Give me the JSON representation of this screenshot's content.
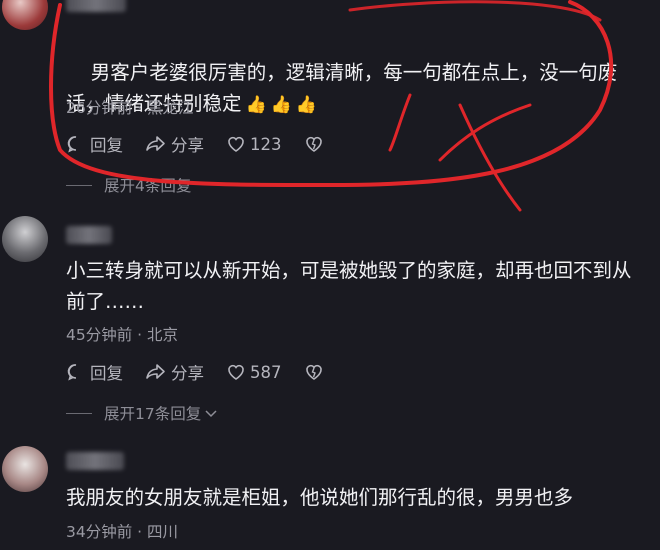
{
  "comments": [
    {
      "text": "男客户老婆很厉害的，逻辑清晰，每一句都在点上，没一句废话，情绪还特别稳定",
      "emojis": [
        "👍",
        "👍",
        "👍"
      ],
      "meta": "26分钟前 · 黑龙江",
      "reply": "回复",
      "share": "分享",
      "likes": "123",
      "expand": "展开4条回复"
    },
    {
      "text": "小三转身就可以从新开始，可是被她毁了的家庭，却再也回不到从前了……",
      "meta": "45分钟前 · 北京",
      "reply": "回复",
      "share": "分享",
      "likes": "587",
      "expand": "展开17条回复"
    },
    {
      "text": "我朋友的女朋友就是柜姐，他说她们那行乱的很，男男也多",
      "meta": "34分钟前 · 四川"
    }
  ],
  "colors": {
    "annotation": "#e0262a",
    "background": "#1a1a21"
  },
  "icons": [
    "reply-icon",
    "share-icon",
    "heart-icon",
    "dislike-heart-icon",
    "chevron-down-icon"
  ]
}
